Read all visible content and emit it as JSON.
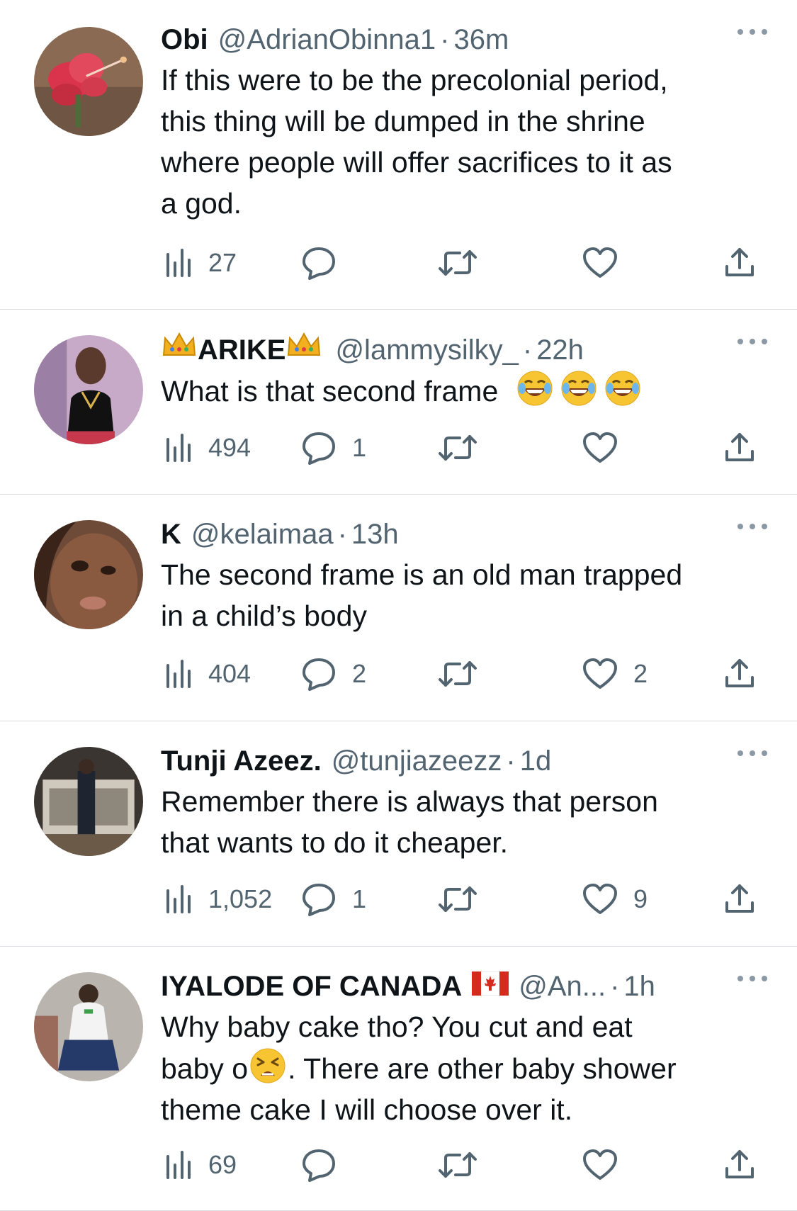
{
  "tweets": [
    {
      "name": "Obi",
      "handle": "@AdrianObinna1",
      "time": "36m",
      "text_lines": [
        "If this were to be the precolonial period,",
        "this thing will be dumped in the shrine",
        "where people will offer sacrifices to it as",
        "a god."
      ],
      "views": "27",
      "replies": "",
      "retweets": "",
      "likes": ""
    },
    {
      "name": "ARIKE",
      "handle": "@lammysilky_",
      "time": "22h",
      "text": "What is that second frame",
      "views": "494",
      "replies": "1",
      "retweets": "",
      "likes": ""
    },
    {
      "name": "K",
      "handle": "@kelaimaa",
      "time": "13h",
      "text_lines": [
        "The second frame is an old man trapped",
        "in a child’s body"
      ],
      "views": "404",
      "replies": "2",
      "retweets": "",
      "likes": "2"
    },
    {
      "name": "Tunji Azeez.",
      "handle": "@tunjiazeezz",
      "time": "1d",
      "text_lines": [
        "Remember there is always that person",
        "that wants to do it cheaper."
      ],
      "views": "1,052",
      "replies": "1",
      "retweets": "",
      "likes": "9"
    },
    {
      "name": "IYALODE OF CANADA",
      "handle": "@An...",
      "time": "1h",
      "text_line1": "Why baby cake tho? You cut and eat",
      "text_line2_a": "baby o",
      "text_line2_b": ". There are other baby shower",
      "text_line3": "theme cake I will choose over it.",
      "views": "69",
      "replies": "",
      "retweets": "",
      "likes": ""
    }
  ],
  "separator": "·",
  "colors": {
    "text": "#0f1419",
    "secondary": "#536471",
    "divider": "#d9dde1"
  },
  "icons": [
    "views-icon",
    "reply-icon",
    "retweet-icon",
    "like-icon",
    "share-icon",
    "more-icon"
  ]
}
